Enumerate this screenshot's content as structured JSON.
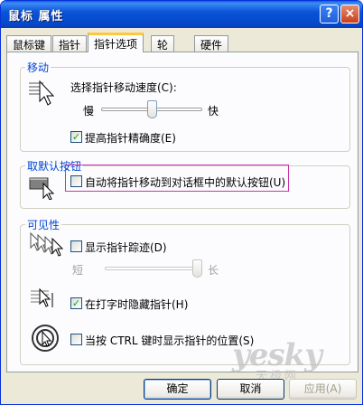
{
  "window": {
    "title": "鼠标 属性",
    "help_button": "?",
    "close_button": "×"
  },
  "tabs": [
    {
      "label": "鼠标键"
    },
    {
      "label": "指针"
    },
    {
      "label": "指针选项"
    },
    {
      "label": "轮"
    },
    {
      "label": "硬件"
    }
  ],
  "active_tab": "指针选项",
  "motion": {
    "title": "移动",
    "speed_label": "选择指针移动速度(C):",
    "slow": "慢",
    "fast": "快",
    "speed_value": 0.5,
    "precision_label": "提高指针精确度(E)",
    "precision_checked": true
  },
  "snap_to": {
    "title": "取默认按钮",
    "checkbox_label": "自动将指针移动到对话框中的默认按钮(U)",
    "checked": false
  },
  "visibility": {
    "title": "可见性",
    "trails_label": "显示指针踪迹(D)",
    "trails_checked": false,
    "short": "短",
    "long": "长",
    "trail_value": 1.0,
    "hide_label": "在打字时隐藏指针(H)",
    "hide_checked": true,
    "ctrl_label": "当按 CTRL 键时显示指针的位置(S)",
    "ctrl_checked": false
  },
  "buttons": {
    "ok": "确定",
    "cancel": "取消",
    "apply": "应用(A)"
  },
  "watermark": {
    "text": "yesky",
    "sub": "天极网"
  },
  "colors": {
    "group_title": "#0046d5",
    "titlebar": "#0a55d8",
    "check": "#21a121"
  }
}
